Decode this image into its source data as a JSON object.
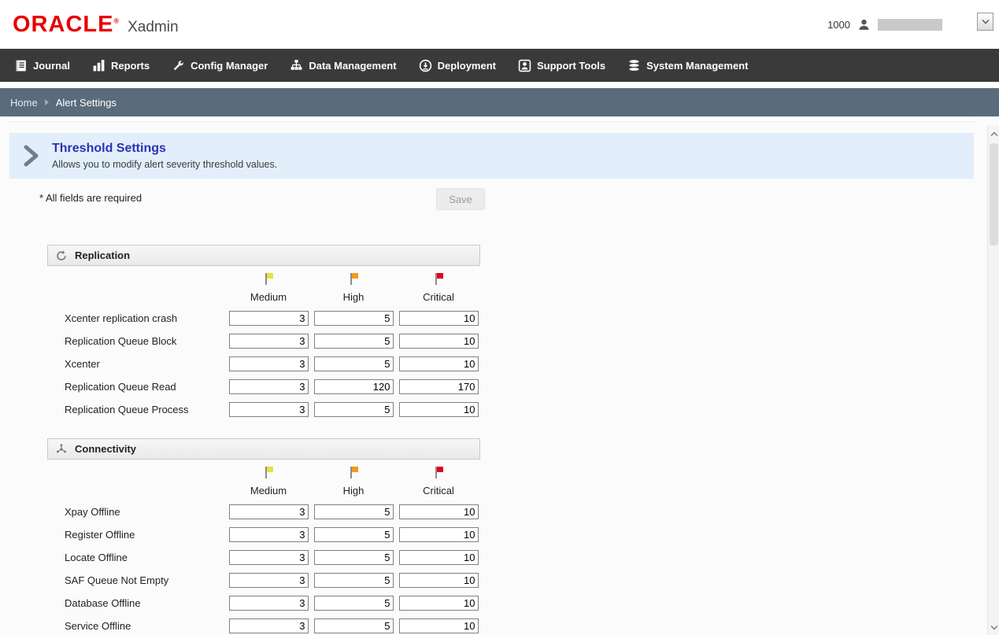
{
  "colors": {
    "brand_red": "#e80000",
    "nav_bg": "#3a3a3a",
    "breadcrumb_bg": "#5a6b7c",
    "banner_bg": "#e2eefa",
    "title_color": "#2d31b8"
  },
  "header": {
    "brand": "ORACLE",
    "registered_mark": "®",
    "app_name": "Xadmin",
    "org_id": "1000"
  },
  "nav": {
    "items": [
      {
        "label": "Journal",
        "icon": "journal-icon"
      },
      {
        "label": "Reports",
        "icon": "reports-icon"
      },
      {
        "label": "Config Manager",
        "icon": "config-manager-icon"
      },
      {
        "label": "Data Management",
        "icon": "data-management-icon"
      },
      {
        "label": "Deployment",
        "icon": "deployment-icon"
      },
      {
        "label": "Support Tools",
        "icon": "support-tools-icon"
      },
      {
        "label": "System Management",
        "icon": "system-management-icon"
      }
    ]
  },
  "breadcrumb": {
    "home": "Home",
    "current": "Alert Settings"
  },
  "page": {
    "title": "Threshold Settings",
    "subtitle": "Allows you to modify alert severity threshold values.",
    "required_note": "* All fields are required",
    "save_label": "Save"
  },
  "severity_columns": [
    {
      "label": "Medium",
      "flag_color": "#e3e33c"
    },
    {
      "label": "High",
      "flag_color": "#f29a18"
    },
    {
      "label": "Critical",
      "flag_color": "#e3001e"
    }
  ],
  "sections": [
    {
      "title": "Replication",
      "icon": "replication-icon",
      "rows": [
        {
          "label": "Xcenter replication crash",
          "medium": "3",
          "high": "5",
          "critical": "10"
        },
        {
          "label": "Replication Queue Block",
          "medium": "3",
          "high": "5",
          "critical": "10"
        },
        {
          "label": "Xcenter",
          "medium": "3",
          "high": "5",
          "critical": "10"
        },
        {
          "label": "Replication Queue Read",
          "medium": "3",
          "high": "120",
          "critical": "170"
        },
        {
          "label": "Replication Queue Process",
          "medium": "3",
          "high": "5",
          "critical": "10"
        }
      ]
    },
    {
      "title": "Connectivity",
      "icon": "connectivity-icon",
      "rows": [
        {
          "label": "Xpay Offline",
          "medium": "3",
          "high": "5",
          "critical": "10"
        },
        {
          "label": "Register Offline",
          "medium": "3",
          "high": "5",
          "critical": "10"
        },
        {
          "label": "Locate Offline",
          "medium": "3",
          "high": "5",
          "critical": "10"
        },
        {
          "label": "SAF Queue Not Empty",
          "medium": "3",
          "high": "5",
          "critical": "10"
        },
        {
          "label": "Database Offline",
          "medium": "3",
          "high": "5",
          "critical": "10"
        },
        {
          "label": "Service Offline",
          "medium": "3",
          "high": "5",
          "critical": "10"
        }
      ]
    }
  ]
}
